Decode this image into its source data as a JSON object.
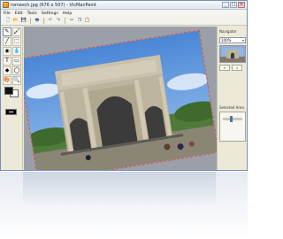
{
  "window": {
    "title": "romesch.jpg (676 x 507) - VicManPaint",
    "minimize": "_",
    "maximize": "□",
    "close": "×"
  },
  "menu": [
    "File",
    "Edit",
    "Tools",
    "Settings",
    "Help"
  ],
  "toolbar": {
    "new": "🗋",
    "open": "📂",
    "save": "💾",
    "print": "🖶",
    "undo": "↶",
    "redo": "↷",
    "cut": "✂",
    "copy": "❐",
    "paste": "📋"
  },
  "tools": {
    "pencil": "✎",
    "brush": "🖌",
    "line": "╱",
    "select": "⬚",
    "fill": "◉",
    "eyedropper": "💧",
    "text": "T",
    "eraser": "▭",
    "shapes": "◆",
    "lasso": "◯",
    "colors": "🎨",
    "zoom": "🔍"
  },
  "sidepanel": {
    "nav_title": "Navigator",
    "zoom_value": "100%",
    "selected_area_title": "Selected Area"
  },
  "colors": {
    "primary": "#111111",
    "secondary": "#ffffff",
    "selection_outline": "#d9534f"
  }
}
